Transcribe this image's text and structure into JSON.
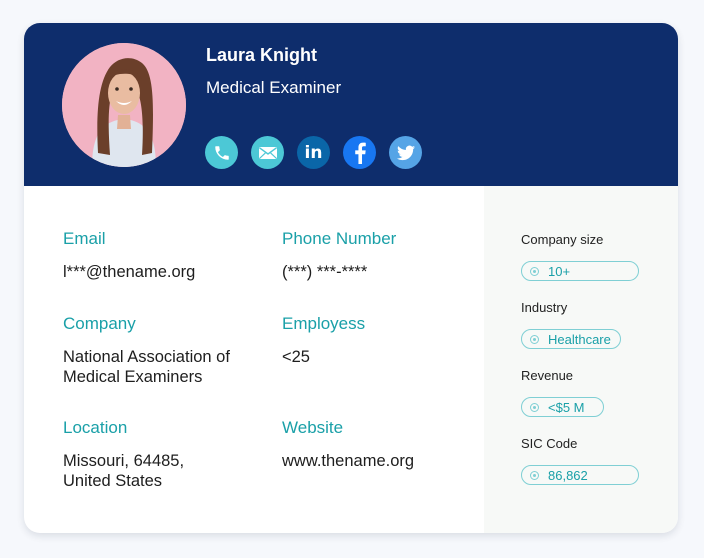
{
  "profile": {
    "name": "Laura Knight",
    "job_title": "Medical Examiner",
    "avatar": "woman-portrait-photo"
  },
  "socials": [
    {
      "icon": "phone-icon",
      "color": "#4cc8d6"
    },
    {
      "icon": "mail-icon",
      "color": "#4cc8d6"
    },
    {
      "icon": "linkedin-icon",
      "color": "#0a66a8",
      "label": "in"
    },
    {
      "icon": "facebook-icon",
      "color": "#1877f2",
      "label": "f"
    },
    {
      "icon": "twitter-icon",
      "color": "#55a4e6"
    }
  ],
  "details": {
    "email": {
      "label": "Email",
      "value": "l***@thename.org"
    },
    "phone": {
      "label": "Phone Number",
      "value": "(***) ***-****"
    },
    "company": {
      "label": "Company",
      "value_line1": "National Association of",
      "value_line2": "Medical Examiners"
    },
    "employees": {
      "label": "Employess",
      "value": "<25"
    },
    "location": {
      "label": "Location",
      "value_line1": "Missouri, 64485,",
      "value_line2": "United States"
    },
    "website": {
      "label": "Website",
      "value": "www.thename.org"
    }
  },
  "sidebar": {
    "company_size": {
      "label": "Company size",
      "value": "10+"
    },
    "industry": {
      "label": "Industry",
      "value": "Healthcare"
    },
    "revenue": {
      "label": "Revenue",
      "value": "<$5 M"
    },
    "sic_code": {
      "label": "SIC Code",
      "value": "86,862"
    }
  },
  "colors": {
    "header_bg": "#0e2d6c",
    "accent": "#1aa0a8",
    "pill_border": "#7fcfd4"
  }
}
